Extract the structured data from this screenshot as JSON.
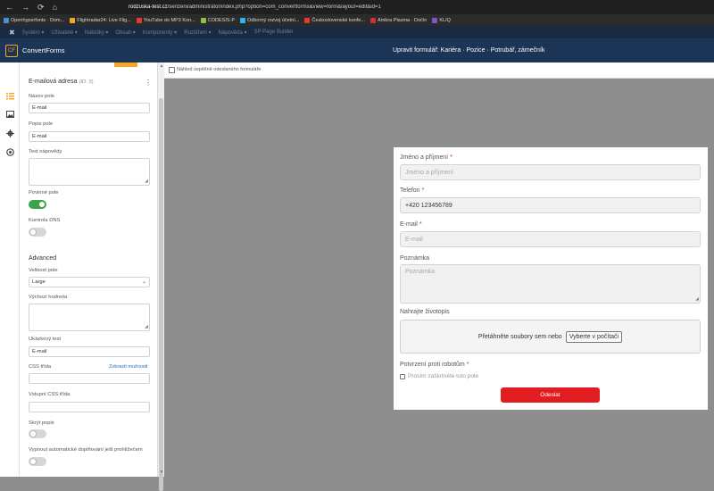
{
  "browser": {
    "nav_back": "←",
    "nav_forward": "→",
    "nav_reload": "⟳",
    "nav_home": "⌂",
    "url_host": "rodzuska-test.cz",
    "url_path": "/senzeni/administrator/index.php?option=com_convertforms&view=form&layout=edit&id=1",
    "bookmarks": [
      {
        "label": "Openhyperfonts · Dom...",
        "color": "#4a90d9"
      },
      {
        "label": "Flightradar24: Live Flig...",
        "color": "#f5a623"
      },
      {
        "label": "YouTube do MP3 Kon...",
        "color": "#e53935"
      },
      {
        "label": "CODESIS·P",
        "color": "#8bc34a"
      },
      {
        "label": "Odborný rozvoj účetní...",
        "color": "#29b6f6"
      },
      {
        "label": "Československé konfe...",
        "color": "#e53935"
      },
      {
        "label": "Ambra Plasma · Dočín",
        "color": "#d32f2f"
      },
      {
        "label": "KLIQ",
        "color": "#7e57c2"
      }
    ]
  },
  "joomla": {
    "logo": "✖",
    "menu": [
      "Systém ▾",
      "Uživatelé ▾",
      "Nabídky ▾",
      "Obsah ▾",
      "Komponenty ▾",
      "Rozšíření ▾",
      "Nápověda ▾",
      "SP Page Builder"
    ]
  },
  "app": {
    "logo_text": "CF",
    "name": "ConvertForms",
    "title": "Upravit formulář: Kariéra · Pozice · Potrubář, zámečník"
  },
  "sidebar": {
    "rail_icons": [
      "list-icon",
      "image-icon",
      "gear-icon",
      "target-icon"
    ],
    "field_title": "E-mailová adresa",
    "field_id": "(ID: 3)",
    "dots": "⋮",
    "name_label": "Název pole",
    "name_value": "E-mail",
    "label_label": "Popis pole",
    "label_value": "E-mail",
    "help_label": "Text nápovědy",
    "required_label": "Povinné pole",
    "dns_label": "Kontrola DNS",
    "advanced_title": "Advanced",
    "size_label": "Velikost pole",
    "size_value": "Large",
    "default_label": "Výchozí hodnota",
    "placeholder_label": "Ukázkový text",
    "placeholder_value": "E-mail",
    "css_class_label": "CSS třída",
    "css_link": "Zobrazit možnosti",
    "input_css_label": "Vstupní CSS třída",
    "hide_label_label": "Skrýt popis",
    "autocomplete_label": "Vypnout automatické doplňování ješt prohlížečem"
  },
  "preview": {
    "check_label": "Náhled úspěšně odeslaného formuláře",
    "fields": {
      "name_label": "Jméno a příjmení",
      "name_placeholder": "Jméno a příjmení",
      "phone_label": "Telefon",
      "phone_value": "+420 123456789",
      "email_label": "E-mail",
      "email_placeholder": "E-mail",
      "note_label": "Poznámka",
      "note_placeholder": "Poznámka",
      "cv_label": "Nahrajte životopis",
      "drop_text": "Přetáhněte soubory sem nebo",
      "browse_label": "Vyberte v počítači",
      "captcha_label": "Potvrzení proti robotům",
      "captcha_text": "Prosím zaškrtněte toto pole",
      "submit_label": "Odeslat",
      "required_mark": "*"
    }
  }
}
